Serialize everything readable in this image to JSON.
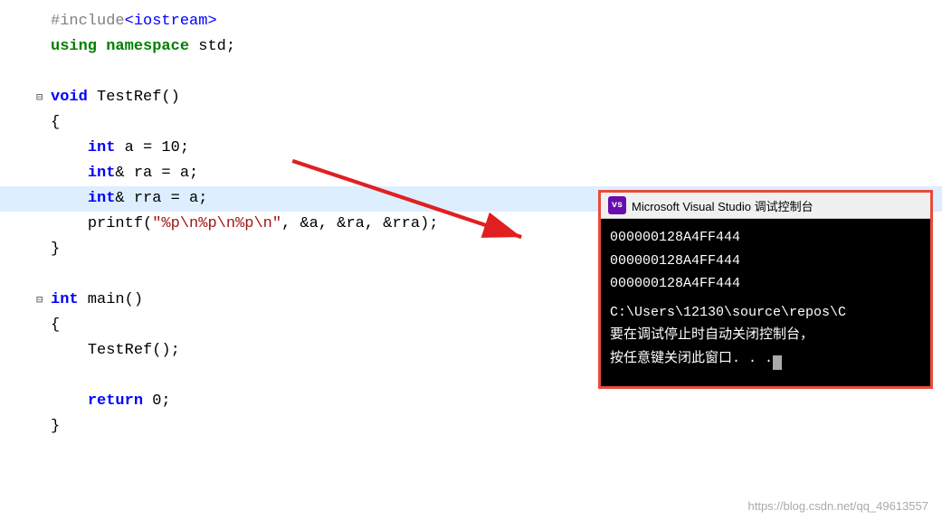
{
  "editor": {
    "background": "#ffffff",
    "lines": [
      {
        "id": 1,
        "indent": 0,
        "content": "#include<iostream>",
        "type": "include"
      },
      {
        "id": 2,
        "indent": 0,
        "content": "using namespace std;",
        "type": "using"
      },
      {
        "id": 3,
        "indent": 0,
        "content": "",
        "type": "empty"
      },
      {
        "id": 4,
        "indent": 0,
        "content": "void TestRef()",
        "type": "funcdef",
        "collapsible": true
      },
      {
        "id": 5,
        "indent": 0,
        "content": "{",
        "type": "brace"
      },
      {
        "id": 6,
        "indent": 1,
        "content": "int a = 10;",
        "type": "code"
      },
      {
        "id": 7,
        "indent": 1,
        "content": "int& ra = a;",
        "type": "code"
      },
      {
        "id": 8,
        "indent": 1,
        "content": "int& rra = a;",
        "type": "code",
        "highlighted": true
      },
      {
        "id": 9,
        "indent": 1,
        "content": "printf(\"%p\\n%p\\n%p\\n\", &a, &ra, &rra);",
        "type": "code"
      },
      {
        "id": 10,
        "indent": 0,
        "content": "}",
        "type": "brace"
      },
      {
        "id": 11,
        "indent": 0,
        "content": "",
        "type": "empty"
      },
      {
        "id": 12,
        "indent": 0,
        "content": "int main()",
        "type": "funcdef",
        "collapsible": true
      },
      {
        "id": 13,
        "indent": 0,
        "content": "{",
        "type": "brace"
      },
      {
        "id": 14,
        "indent": 1,
        "content": "TestRef();",
        "type": "code"
      },
      {
        "id": 15,
        "indent": 0,
        "content": "",
        "type": "empty"
      },
      {
        "id": 16,
        "indent": 1,
        "content": "return 0;",
        "type": "code"
      },
      {
        "id": 17,
        "indent": 0,
        "content": "}",
        "type": "brace"
      }
    ]
  },
  "console": {
    "title": "Microsoft Visual Studio 调试控制台",
    "icon_label": "vs",
    "output_lines": [
      "000000128A4FF444",
      "000000128A4FF444",
      "000000128A4FF444"
    ],
    "footer_lines": [
      "C:\\Users\\12130\\source\\repos\\C",
      "要在调试停止时自动关闭控制台，",
      "按任意键关闭此窗口. . ."
    ]
  },
  "watermark": {
    "text": "https://blog.csdn.net/qq_49613557"
  }
}
